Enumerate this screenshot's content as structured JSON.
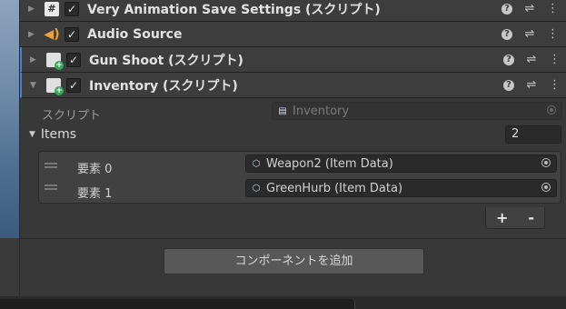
{
  "components": [
    {
      "title": "Very Animation Save Settings (スクリプト)",
      "icon": "script-hash-icon",
      "enabled": "✓"
    },
    {
      "title": "Audio Source",
      "icon": "speaker-icon",
      "enabled": "✓"
    },
    {
      "title": "Gun Shoot (スクリプト)",
      "icon": "csharp-script-icon",
      "enabled": "✓"
    },
    {
      "title": "Inventory (スクリプト)",
      "icon": "csharp-script-icon",
      "enabled": "✓",
      "expanded": true
    }
  ],
  "header_icons": {
    "help": "?",
    "settings": "⇌",
    "menu": "⋮"
  },
  "inventory": {
    "script_label": "スクリプト",
    "script_value": "Inventory",
    "items_label": "Items",
    "items_count": "2",
    "elements": [
      {
        "label": "要素 0",
        "value": "Weapon2 (Item Data)"
      },
      {
        "label": "要素 1",
        "value": "GreenHurb (Item Data)"
      }
    ],
    "add_symbol": "+",
    "remove_symbol": "-"
  },
  "add_component_label": "コンポーネントを追加",
  "colors": {
    "background": "#383838",
    "header": "#3d3d3d",
    "selection_accent": "#4c7ecc",
    "button": "#585858"
  }
}
